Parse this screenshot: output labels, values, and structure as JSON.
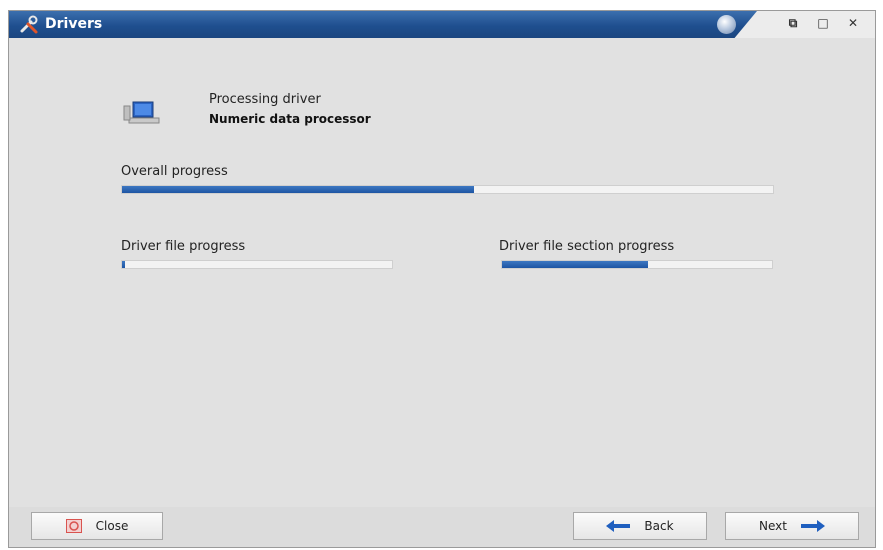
{
  "window": {
    "title": "Drivers",
    "title_icon": "wrench-screwdriver-icon",
    "restore_glyph": "⧉",
    "maximize_glyph": "□",
    "close_glyph": "✕"
  },
  "status": {
    "label": "Processing driver",
    "driver_name": "Numeric data processor",
    "icon": "driver-computer-icon"
  },
  "progress": {
    "overall": {
      "label": "Overall progress",
      "value": 0.54
    },
    "file": {
      "label": "Driver file progress",
      "value": 0.01
    },
    "section": {
      "label": "Driver file section progress",
      "value": 0.54
    }
  },
  "footer": {
    "close_label": "Close",
    "back_label": "Back",
    "next_label": "Next"
  },
  "colors": {
    "title_blue": "#1f4f8f",
    "progress_blue": "#1d55a3",
    "close_icon_red": "#d9534f",
    "arrow_blue": "#1f5fbf"
  }
}
